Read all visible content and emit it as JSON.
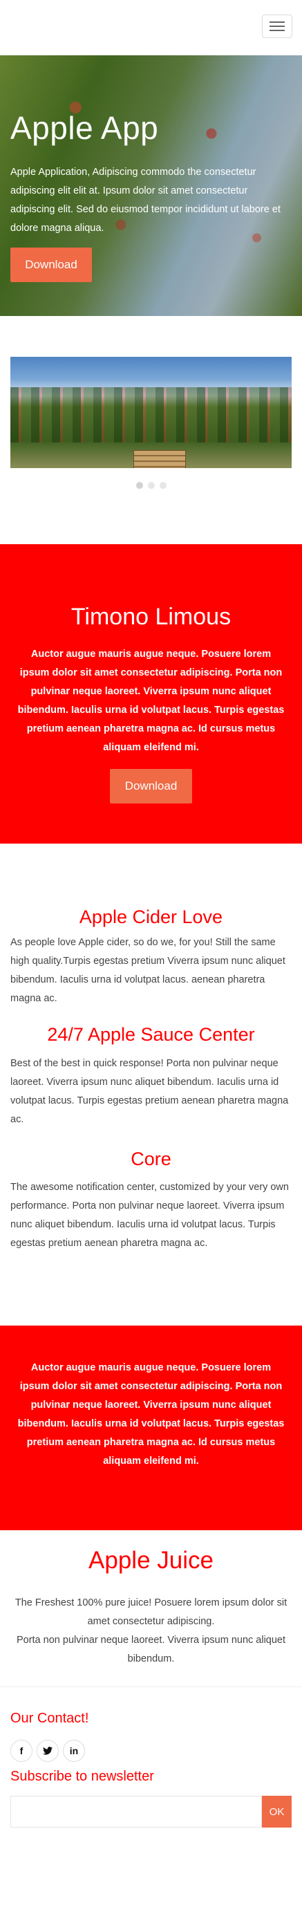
{
  "header": {
    "menu_icon": "hamburger-icon"
  },
  "hero": {
    "title": "Apple App",
    "text": "Apple Application, Adipiscing commodo the consectetur adipiscing elit elit at. Ipsum dolor sit amet consectetur adipiscing elit. Sed do eiusmod tempor incididunt ut labore et dolore magna aliqua.",
    "button": "Download"
  },
  "slider": {
    "dots": 3,
    "active_dot": 0
  },
  "promo": {
    "title": "Timono Limous",
    "text": "Auctor augue mauris augue neque. Posuere lorem ipsum dolor sit amet consectetur adipiscing. Porta non pulvinar neque laoreet. Viverra ipsum nunc aliquet bibendum. Iaculis urna id volutpat lacus. Turpis egestas pretium aenean pharetra magna ac. Id cursus metus aliquam eleifend mi.",
    "button": "Download"
  },
  "features": [
    {
      "title": "Apple Cider Love",
      "text": "As people love Apple cider, so do we, for you! Still the same high quality.Turpis egestas pretium Viverra ipsum nunc aliquet bibendum. Iaculis urna id volutpat lacus. aenean pharetra magna ac."
    },
    {
      "title": "24/7 Apple Sauce Center",
      "text": "Best of the best in quick response! Porta non pulvinar neque laoreet. Viverra ipsum nunc aliquet bibendum. Iaculis urna id volutpat lacus. Turpis egestas pretium aenean pharetra magna ac."
    },
    {
      "title": "Core",
      "text": "The awesome notification center, customized by your very own performance. Porta non pulvinar neque laoreet. Viverra ipsum nunc aliquet bibendum. Iaculis urna id volutpat lacus. Turpis egestas pretium aenean pharetra magna ac."
    }
  ],
  "banner": {
    "text": "Auctor augue mauris augue neque. Posuere lorem ipsum dolor sit amet consectetur adipiscing. Porta non pulvinar neque laoreet. Viverra ipsum nunc aliquet bibendum. Iaculis urna id volutpat lacus. Turpis egestas pretium aenean pharetra magna ac. Id cursus metus aliquam eleifend mi."
  },
  "juice": {
    "title": "Apple Juice",
    "line1": "The Freshest 100% pure juice! Posuere lorem ipsum dolor sit amet consectetur adipiscing.",
    "line2": "Porta non pulvinar neque laoreet. Viverra ipsum nunc aliquet bibendum."
  },
  "footer": {
    "contact_title": "Our Contact!",
    "socials": [
      {
        "icon": "facebook-icon",
        "glyph": "f"
      },
      {
        "icon": "twitter-icon",
        "glyph": "t"
      },
      {
        "icon": "linkedin-icon",
        "glyph": "in"
      }
    ],
    "subscribe_title": "Subscribe to newsletter",
    "ok_label": "OK"
  },
  "colors": {
    "accent": "#ff0000",
    "button": "#ef6a45"
  }
}
